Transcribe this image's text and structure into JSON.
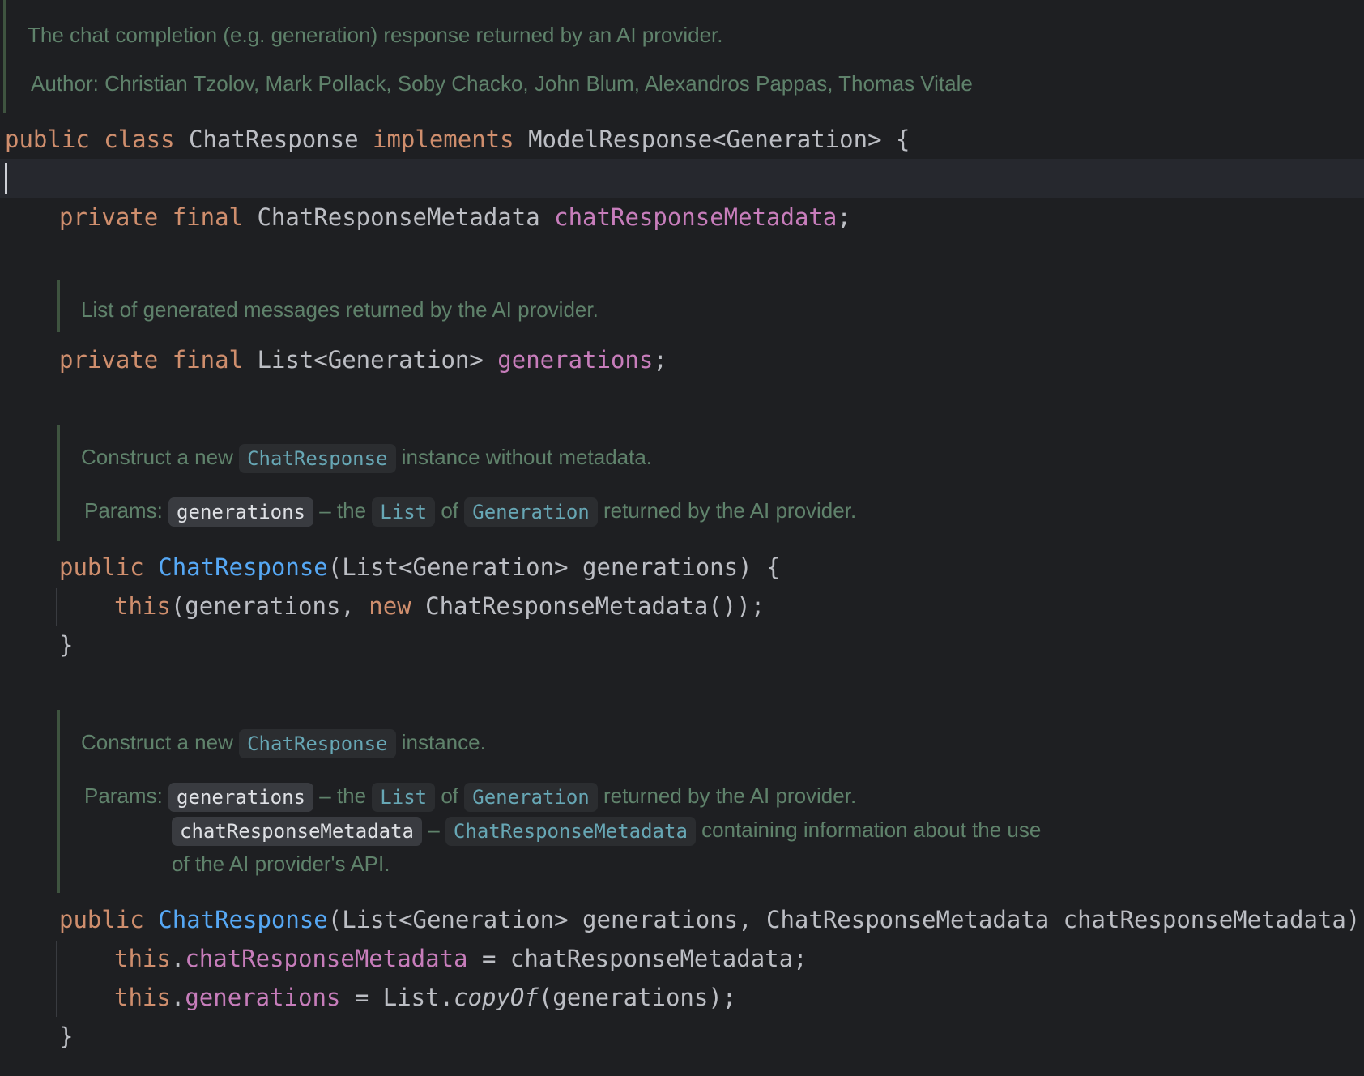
{
  "class_doc": {
    "description": "The chat completion (e.g. generation) response returned by an AI provider.",
    "author_label": "Author:",
    "authors": "Christian Tzolov, Mark Pollack, Soby Chacko, John Blum, Alexandros Pappas, Thomas Vitale"
  },
  "class_decl": {
    "public": "public",
    "class": "class",
    "name": "ChatResponse",
    "implements": "implements",
    "supertype": "ModelResponse<Generation> {"
  },
  "field1": {
    "private": "private",
    "final": "final",
    "type": "ChatResponseMetadata",
    "name": "chatResponseMetadata",
    "end": ";"
  },
  "field2_doc": {
    "text": "List of generated messages returned by the AI provider."
  },
  "field2": {
    "private": "private",
    "final": "final",
    "type": "List<Generation>",
    "name": "generations",
    "end": ";"
  },
  "ctor1_doc": {
    "pre": "Construct a new",
    "chip": "ChatResponse",
    "post": "instance without metadata.",
    "params_label": "Params:",
    "param": "generations",
    "dash": "– the",
    "list": "List",
    "of": "of",
    "generation": "Generation",
    "tail": "returned by the AI provider."
  },
  "ctor1": {
    "public": "public",
    "name": "ChatResponse",
    "sig": "(List<Generation> generations) {",
    "this": "this",
    "call": "(generations, ",
    "new": "new",
    "call_end": " ChatResponseMetadata());",
    "close": "}"
  },
  "ctor2_doc": {
    "pre": "Construct a new",
    "chip": "ChatResponse",
    "post": "instance.",
    "params_label": "Params:",
    "param1": "generations",
    "dash1": "– the",
    "list": "List",
    "of": "of",
    "generation": "Generation",
    "tail1": "returned by the AI provider.",
    "param2": "chatResponseMetadata",
    "dash2": "–",
    "type2": "ChatResponseMetadata",
    "tail2": "containing information about the use",
    "tail3": "of the AI provider's API."
  },
  "ctor2": {
    "public": "public",
    "name": "ChatResponse",
    "sig": "(List<Generation> generations, ChatResponseMetadata chatResponseMetadata) {",
    "this": "this",
    "dot": ".",
    "field1": "chatResponseMetadata",
    "assign1": " = chatResponseMetadata;",
    "field2": "generations",
    "assign2": " = List.",
    "copyof": "copyOf",
    "assign2_end": "(generations);",
    "close": "}"
  },
  "colors": {
    "background": "#1e1f22",
    "keyword": "#cf8e6d",
    "field": "#c77dbb",
    "method": "#56a8f5",
    "doc_text": "#5f826b",
    "doc_link": "#67a7b5",
    "plain": "#bcbec4"
  }
}
